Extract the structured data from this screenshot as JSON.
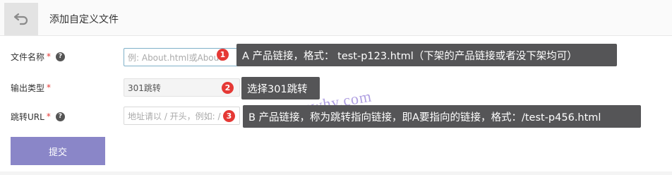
{
  "header": {
    "title": "添加自定义文件"
  },
  "fields": {
    "file_name": {
      "label": "文件名称",
      "required": "*",
      "help": "?",
      "placeholder": "例: About.html或About"
    },
    "output_type": {
      "label": "输出类型",
      "required": "*",
      "value": "301跳转"
    },
    "redirect_url": {
      "label": "跳转URL",
      "required": "*",
      "help": "?",
      "placeholder": "地址请以 / 开头，例如: /"
    }
  },
  "submit_label": "提交",
  "annotations": [
    {
      "number": "1",
      "text": "A 产品链接，格式： test-p123.html（下架的产品链接或者没下架均可）"
    },
    {
      "number": "2",
      "text": "选择301跳转"
    },
    {
      "number": "3",
      "text": "B 产品链接，称为跳转指向链接，即A要指向的链接，格式：/test-p456.html"
    }
  ],
  "watermark": "www.lanswhy.com",
  "icons": {
    "back": "back-arrow-icon",
    "help": "question-circle-icon"
  },
  "colors": {
    "submit": "#8a86c8",
    "badge": "#e53935",
    "tooltip": "#555557"
  }
}
